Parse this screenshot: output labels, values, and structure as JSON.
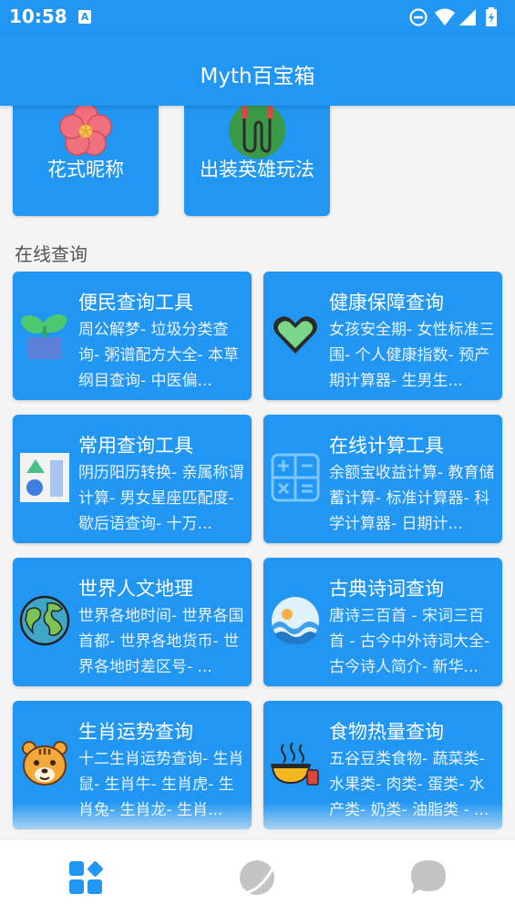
{
  "status_bar": {
    "time": "10:58",
    "notification_icon_letter": "A",
    "icons": [
      "do-not-disturb-icon",
      "wifi-icon",
      "cell-signal-icon",
      "battery-charging-icon"
    ]
  },
  "app_bar": {
    "title": "Myth百宝箱"
  },
  "top_cards": [
    {
      "label": "花式昵称",
      "icon": "flower-icon"
    },
    {
      "label": "出装英雄玩法",
      "icon": "jump-rope-icon"
    }
  ],
  "section_title": "在线查询",
  "cards": [
    {
      "title": "便民查询工具",
      "desc": "周公解梦- 垃圾分类查询- 粥谱配方大全- 本草纲目查询- 中医偏...",
      "icon": "potted-plant-icon"
    },
    {
      "title": "健康保障查询",
      "desc": "女孩安全期- 女性标准三围- 个人健康指数- 预产期计算器- 生男生...",
      "icon": "heart-icon"
    },
    {
      "title": "常用查询工具",
      "desc": "阴历阳历转换- 亲属称谓计算- 男女星座匹配度- 歇后语查询- 十万...",
      "icon": "shapes-icon"
    },
    {
      "title": "在线计算工具",
      "desc": "余额宝收益计算- 教育储蓄计算- 标准计算器- 科学计算器- 日期计...",
      "icon": "calculator-icon"
    },
    {
      "title": "世界人文地理",
      "desc": "世界各地时间- 世界各国首都- 世界各地货币- 世界各地时差区号- ...",
      "icon": "globe-icon"
    },
    {
      "title": "古典诗词查询",
      "desc": "唐诗三百首 - 宋词三百首 - 古今中外诗词大全- 古今诗人简介- 新华...",
      "icon": "sea-wave-icon"
    },
    {
      "title": "生肖运势查询",
      "desc": "十二生肖运势查询- 生肖鼠- 生肖牛- 生肖虎- 生肖兔- 生肖龙- 生肖...",
      "icon": "tiger-icon"
    },
    {
      "title": "食物热量查询",
      "desc": "五谷豆类食物- 蔬菜类- 水果类- 肉类- 蛋类- 水产类- 奶类- 油脂类 - ...",
      "icon": "food-bowl-icon"
    }
  ],
  "bottom_nav": [
    {
      "name": "home",
      "icon": "grid-icon",
      "active": true
    },
    {
      "name": "discover",
      "icon": "planet-icon",
      "active": false
    },
    {
      "name": "messages",
      "icon": "chat-bubble-icon",
      "active": false
    }
  ],
  "colors": {
    "primary": "#2196f3",
    "background": "#f4f4f4",
    "inactive_nav": "#c4c4c4"
  }
}
